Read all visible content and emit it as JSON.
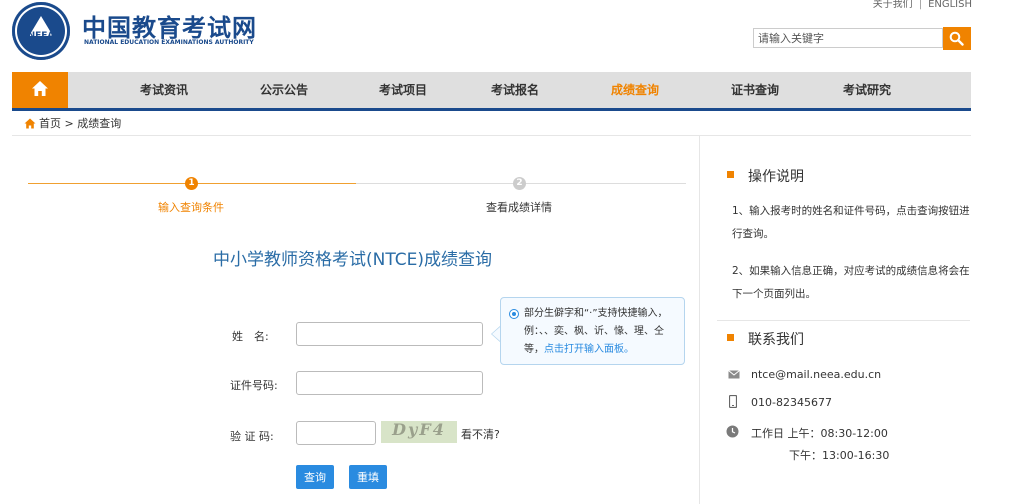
{
  "header": {
    "logo_cn": "中国教育考试网",
    "logo_en": "NATIONAL EDUCATION EXAMINATIONS AUTHORITY",
    "logo_emblem_text": "NEEA",
    "top_links": [
      "关于我们",
      "ENGLISH"
    ],
    "search": {
      "placeholder": "请输入关键字"
    }
  },
  "nav": {
    "items": [
      "考试资讯",
      "公示公告",
      "考试项目",
      "考试报名",
      "成绩查询",
      "证书查询",
      "考试研究"
    ],
    "active": "成绩查询"
  },
  "breadcrumb": {
    "home": "首页",
    "sep": ">",
    "current": "成绩查询"
  },
  "steps": [
    {
      "num": "1",
      "label": "输入查询条件",
      "state": "active"
    },
    {
      "num": "2",
      "label": "查看成绩详情",
      "state": "pending"
    }
  ],
  "form": {
    "title": "中小学教师资格考试(NTCE)成绩查询",
    "name_label": "姓　名:",
    "id_label": "证件号码:",
    "captcha_label": "验 证 码:",
    "captcha_image_text": "DyF4",
    "refresh_text": "看不清?",
    "submit_label": "查询",
    "reset_label": "重填"
  },
  "tip": {
    "text": "部分生僻字和“·”支持快捷输入，例：、、奕、枫、䜣、㥟、瑆、仝等，",
    "link": "点击打开输入面板。"
  },
  "instructions": {
    "title": "操作说明",
    "items": [
      "1、输入报考时的姓名和证件号码，点击查询按钮进行查询。",
      "2、如果输入信息正确，对应考试的成绩信息将会在下一个页面列出。"
    ]
  },
  "contact": {
    "title": "联系我们",
    "email": "ntce@mail.neea.edu.cn",
    "phone": "010-82345677",
    "hours_1": "工作日 上午：08:30-12:00",
    "hours_2": "下午：13:00-16:30"
  },
  "colors": {
    "brand_blue": "#1a4a8c",
    "accent_orange": "#f08300",
    "button_blue": "#2a8be0"
  }
}
